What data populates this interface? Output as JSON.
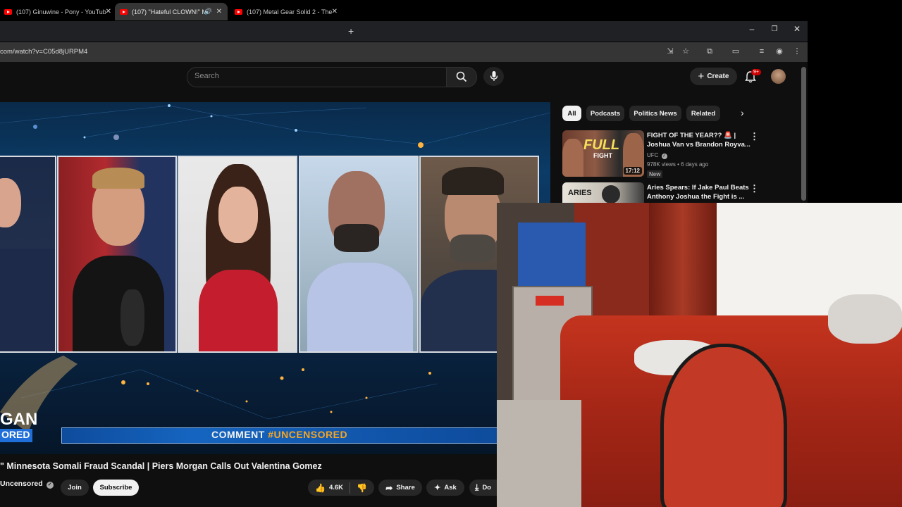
{
  "tabs": [
    {
      "title": "(107) Ginuwine - Pony - YouTub",
      "active": false
    },
    {
      "title": "(107) \"Hateful CLOWN!\" Mi",
      "active": true
    },
    {
      "title": "(107) Metal Gear Solid 2 - The",
      "active": false
    }
  ],
  "new_tab_icon": "plus-icon",
  "address": "com/watch?v=C05d8jURPM4",
  "search": {
    "placeholder": "Search"
  },
  "header": {
    "create_label": "Create",
    "notifications_badge": "9+"
  },
  "video_overlay": {
    "comment_text_prefix": "COMMENT ",
    "comment_text_tag": "#UNCENSORED",
    "show_logo_line1": "GAN",
    "show_logo_line2": "ORED"
  },
  "chips": [
    "All",
    "Podcasts",
    "Politics News",
    "Related"
  ],
  "recommendations": [
    {
      "title_line1": "FIGHT OF THE YEAR?? 🚨 |",
      "title_line2": "Joshua Van vs Brandon Royva...",
      "channel": "UFC",
      "meta": "978K views • 6 days ago",
      "duration": "17:12",
      "badge": "New",
      "thumb_text": "FULL",
      "thumb_sub": "FIGHT"
    },
    {
      "title_line1": "Aries Spears: If Jake Paul Beats",
      "title_line2": "Anthony Joshua the Fight is ...",
      "thumb_text": "ARIES"
    }
  ],
  "video": {
    "title": "\" Minnesota Somali Fraud Scandal | Piers Morgan Calls Out Valentina Gomez",
    "channel": "Uncensored",
    "join_label": "Join",
    "subscribe_label": "Subscribe",
    "likes": "4.6K",
    "share_label": "Share",
    "ask_label": "Ask",
    "download_label": "Do"
  },
  "colors": {
    "page_bg": "#0f0f0f",
    "chip_bg": "#272727",
    "accent_red": "#ff0000",
    "comment_bar": "#1565c0",
    "uncensored_orange": "#f5a623"
  }
}
